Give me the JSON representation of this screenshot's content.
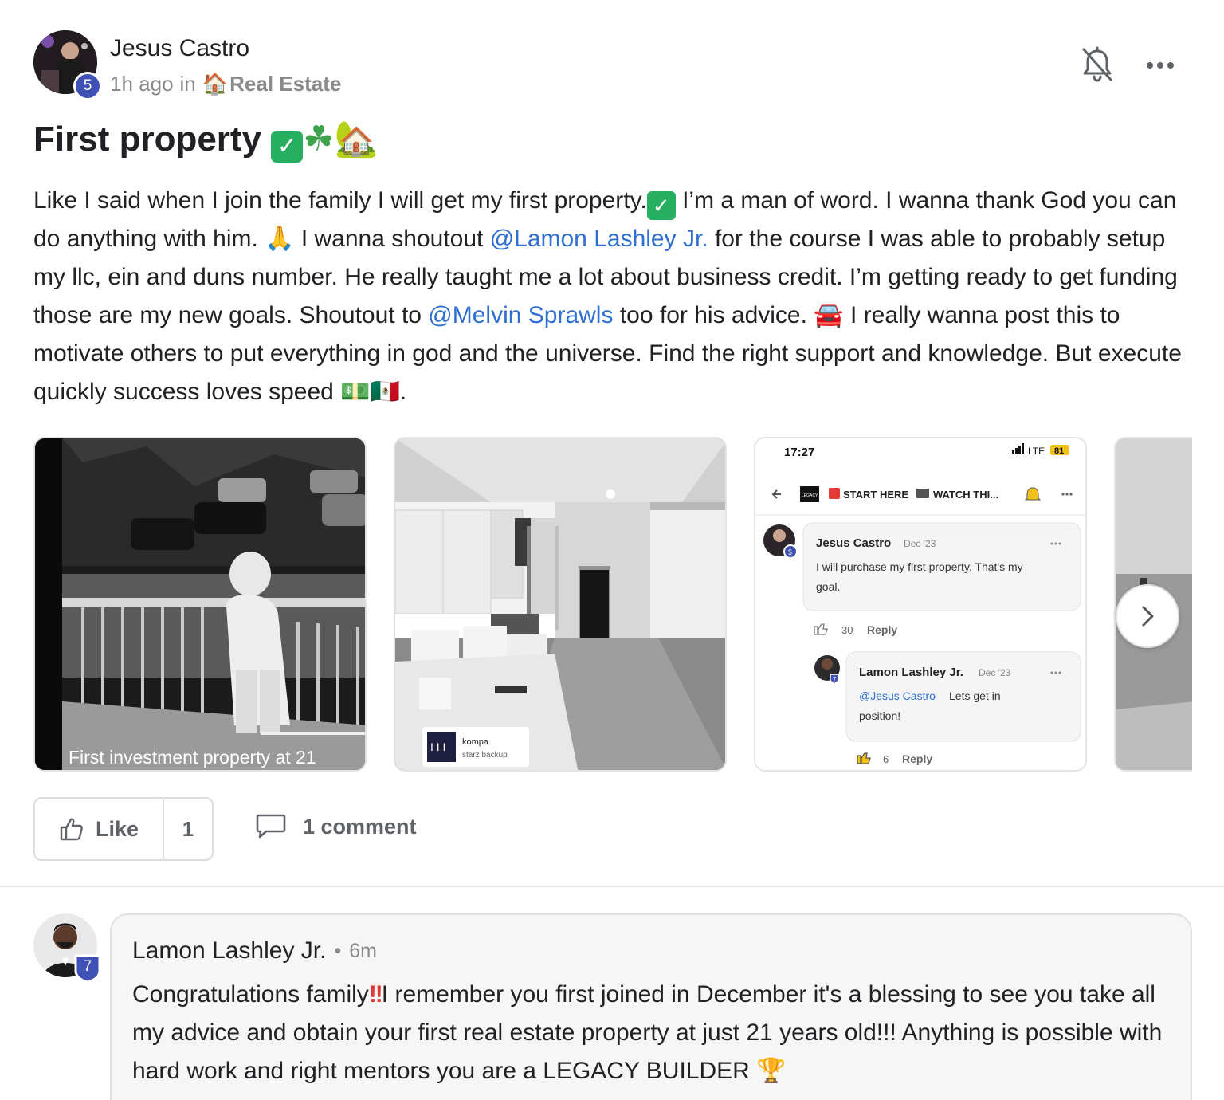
{
  "post": {
    "author": "Jesus Castro",
    "author_level": "5",
    "time_ago": "1h ago",
    "in_word": "in",
    "category": "Real Estate",
    "title": "First property",
    "body": {
      "p1": "Like I said when I join the family I will get my first property.",
      "p2": " I’m a man of word. I wanna thank God you can do anything with him. ",
      "p3": " I wanna shoutout ",
      "mention1": "@Lamon Lashley Jr.",
      "p4": " for the course I was able to probably setup my llc, ein and duns number. He really taught me a lot about business credit. I’m getting ready to get funding those are my new goals. Shoutout to ",
      "mention2": "@Melvin Sprawls",
      "p5": " too for his advice. ",
      "p6": " I really wanna post this to motivate others to put everything in god and the universe. Find the right support and knowledge. But execute quickly success loves speed ",
      "p7": "."
    },
    "like_label": "Like",
    "like_count": "1",
    "comment_count_label": "1 comment"
  },
  "gallery": {
    "image1_caption": "First investment property at 21",
    "image2_music_title": "kompa",
    "image2_music_sub": "starz backup",
    "image3": {
      "status_time": "17:27",
      "status_net": "LTE",
      "status_battery": "81",
      "header_logo": "LEGACY BUILDER",
      "header_title": "START HERE",
      "header_title2": "WATCH THI...",
      "c1_name": "Jesus Castro",
      "c1_date": "Dec '23",
      "c1_level": "5",
      "c1_text1": "I will purchase my first property. That's my",
      "c1_text2": "goal.",
      "c1_likes": "30",
      "c1_reply": "Reply",
      "c2_name": "Lamon Lashley Jr.",
      "c2_date": "Dec '23",
      "c2_level": "7",
      "c2_mention": "@Jesus Castro",
      "c2_text1": " Lets get in",
      "c2_text2": "position!",
      "c2_likes": "6",
      "c2_reply": "Reply"
    }
  },
  "comment": {
    "author": "Lamon Lashley Jr.",
    "author_level": "7",
    "time": "6m",
    "body1": "Congratulations family",
    "body2": "I remember you first joined in December it's a blessing to see you take all my advice and obtain your first real estate property at just 21 years old!!! Anything is possible with hard work and right mentors you are a LEGACY BUILDER "
  },
  "icons": {
    "bell": "bell-off-icon",
    "more": "more-horizontal-icon",
    "like": "thumbs-up-icon",
    "comment": "comment-bubble-icon",
    "next": "chevron-right-icon"
  }
}
